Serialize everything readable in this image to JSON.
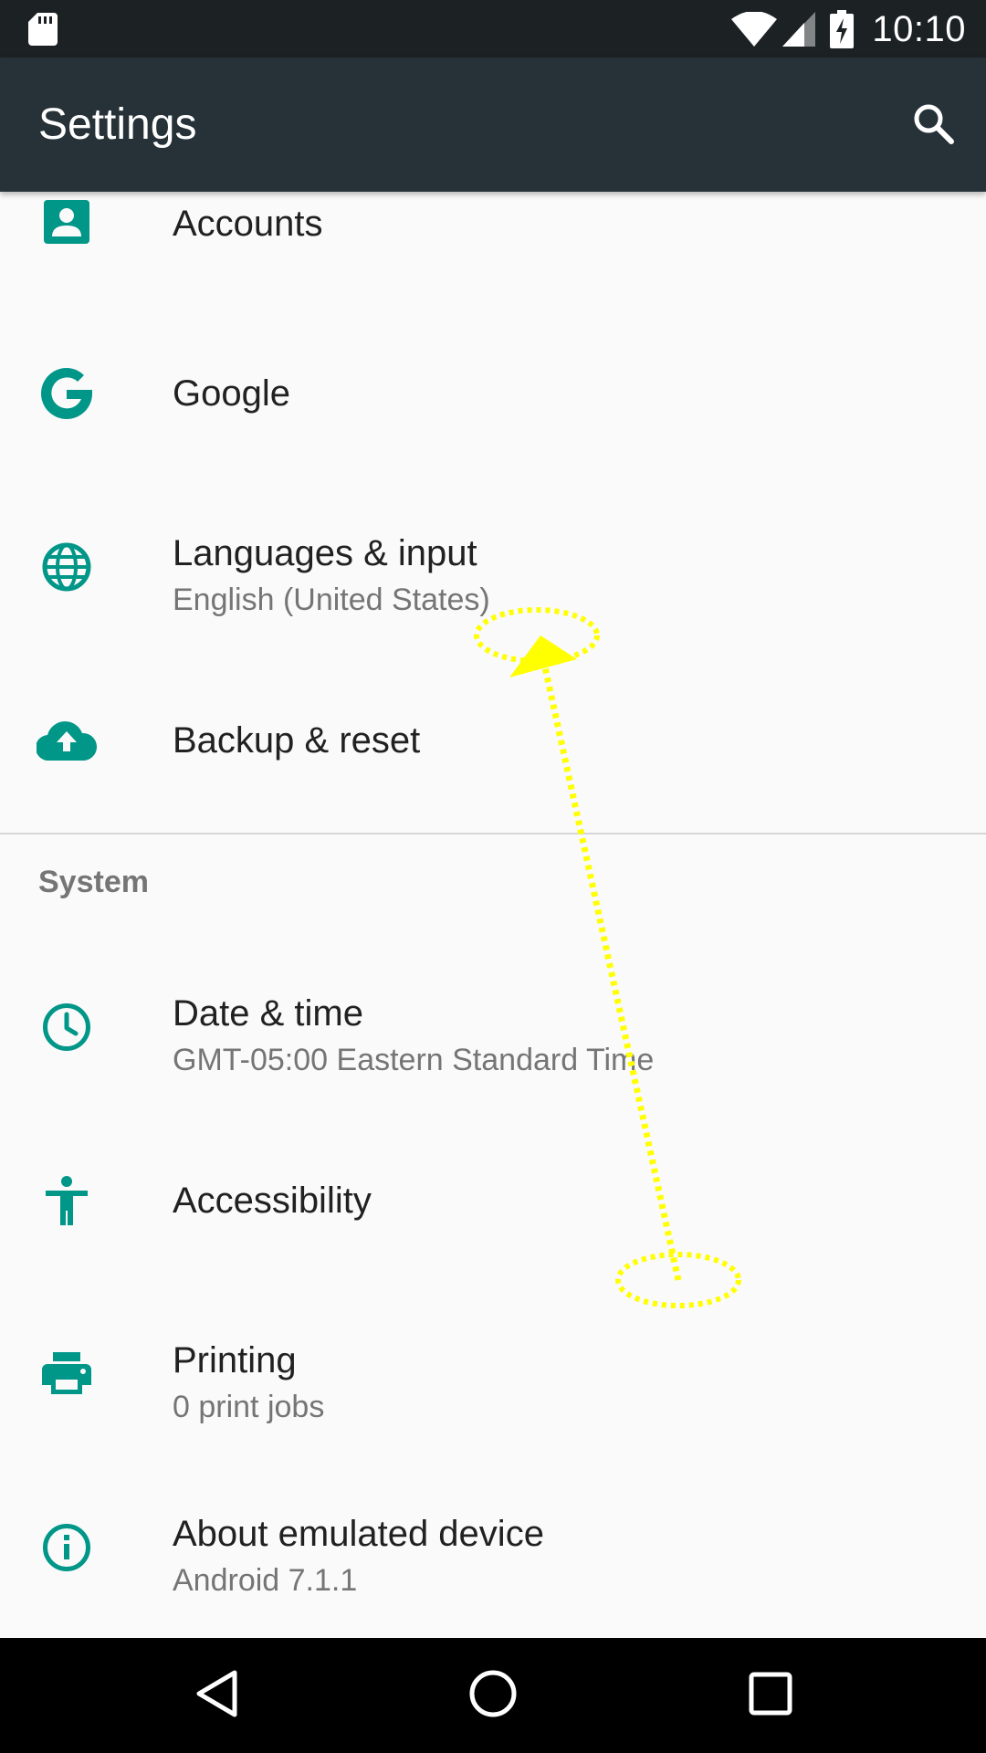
{
  "status_bar": {
    "time": "10:10",
    "icons": [
      "sd-card-icon",
      "wifi-icon",
      "cellular-signal-icon",
      "battery-charging-icon"
    ]
  },
  "app_bar": {
    "title": "Settings",
    "search_icon": "search-icon"
  },
  "items": [
    {
      "id": "accounts",
      "title": "Accounts",
      "summary": "",
      "icon": "account-box-icon"
    },
    {
      "id": "google",
      "title": "Google",
      "summary": "",
      "icon": "google-g-icon"
    },
    {
      "id": "languages",
      "title": "Languages & input",
      "summary": "English (United States)",
      "icon": "globe-icon"
    },
    {
      "id": "backup",
      "title": "Backup & reset",
      "summary": "",
      "icon": "cloud-upload-icon"
    }
  ],
  "system_section": {
    "header": "System",
    "items": [
      {
        "id": "date-time",
        "title": "Date & time",
        "summary": "GMT-05:00 Eastern Standard Time",
        "icon": "clock-icon"
      },
      {
        "id": "accessibility",
        "title": "Accessibility",
        "summary": "",
        "icon": "accessibility-icon"
      },
      {
        "id": "printing",
        "title": "Printing",
        "summary": "0 print jobs",
        "icon": "printer-icon"
      },
      {
        "id": "about",
        "title": "About emulated device",
        "summary": "Android 7.1.1",
        "icon": "info-icon"
      }
    ]
  },
  "nav_bar": {
    "buttons": [
      "back-icon",
      "home-icon",
      "recents-icon"
    ]
  },
  "colors": {
    "status_bar": "#1c2124",
    "app_bar": "#263238",
    "accent": "#009688",
    "background": "#fafafa",
    "gesture": "#ffff00"
  }
}
